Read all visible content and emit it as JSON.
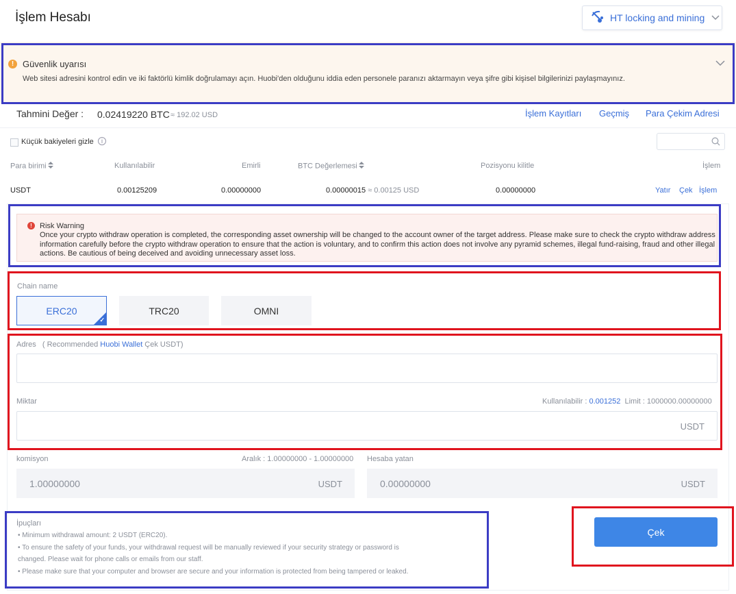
{
  "header": {
    "title": "İşlem Hesabı",
    "ht_button_label": "HT locking and mining"
  },
  "security_warning": {
    "title": "Güvenlik uyarısı",
    "text": "Web sitesi adresini kontrol edin ve iki faktörlü kimlik doğrulamayı açın. Huobi'den olduğunu iddia eden personele paranızı aktarmayın veya şifre gibi kişisel bilgilerinizi paylaşmayınız."
  },
  "estimate": {
    "label": "Tahmini Değer :",
    "value": "0.02419220 BTC",
    "usd": "≈ 192.02 USD"
  },
  "top_links": [
    "İşlem Kayıtları",
    "Geçmiş",
    "Para Çekim Adresi"
  ],
  "balance_filter": {
    "label": "Küçük bakiyeleri gizle"
  },
  "table": {
    "headers": [
      "Para birimi",
      "Kullanılabilir",
      "Emirli",
      "BTC Değerlemesi",
      "Pozisyonu kilitle",
      "İşlem"
    ],
    "row": {
      "currency": "USDT",
      "available": "0.00125209",
      "ordered": "0.00000000",
      "btc_value": "0.00000015",
      "btc_value_usd": "≈ 0.00125 USD",
      "locked": "0.00000000"
    },
    "actions": [
      "Yatır",
      "Çek",
      "İşlem"
    ]
  },
  "risk_warning": {
    "title": "Risk Warning",
    "text": "Once your crypto withdraw operation is completed, the corresponding asset ownership will be changed to the account owner of the target address. Please make sure to check the crypto withdraw address information carefully before the crypto withdraw operation to ensure that the action is voluntary, and to confirm this action does not involve any pyramid schemes, illegal fund-raising, fraud and other illegal actions. Be cautious of being deceived and avoiding unnecessary asset loss."
  },
  "chain": {
    "label": "Chain name",
    "options": [
      "ERC20",
      "TRC20",
      "OMNI"
    ],
    "selected": "ERC20"
  },
  "address": {
    "label": "Adres",
    "hint_prefix": "( Recommended ",
    "hint_link": "Huobi Wallet",
    "hint_suffix": " Çek USDT)",
    "value": "",
    "placeholder": ""
  },
  "amount": {
    "label": "Miktar",
    "available_label": "Kullanılabilir :",
    "available_value": "0.001252",
    "limit_label": "Limit :",
    "limit_value": "1000000.00000000",
    "unit": "USDT",
    "value": ""
  },
  "fee": {
    "label": "komisyon",
    "range_label": "Aralık : 1.00000000 - 1.00000000",
    "value": "1.00000000",
    "unit": "USDT"
  },
  "received": {
    "label": "Hesaba yatan",
    "value": "0.00000000",
    "unit": "USDT"
  },
  "tips": {
    "title": "İpuçları",
    "items": [
      "• Minimum withdrawal amount: 2 USDT (ERC20).",
      "• To ensure the safety of your funds, your withdrawal request will be manually reviewed if your security strategy or password is",
      "changed. Please wait for phone calls or emails from our staff.",
      "• Please make sure that your computer and browser are secure and your information is protected from being tampered or leaked."
    ]
  },
  "submit_label": "Çek",
  "colors": {
    "accent": "#3a6fd8",
    "button": "#3e86e6",
    "annotation_blue": "#3b3cc4",
    "annotation_red": "#e0141e"
  }
}
